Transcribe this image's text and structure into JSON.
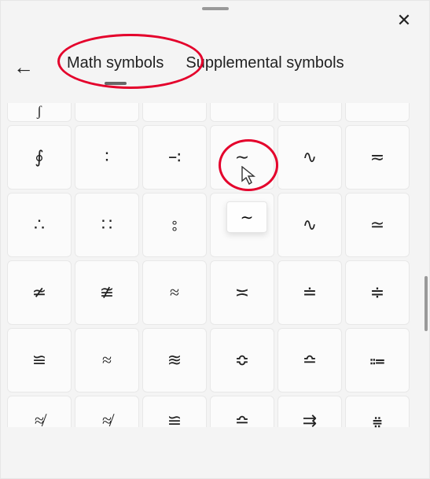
{
  "tabs": {
    "math": "Math symbols",
    "supplemental": "Supplemental symbols"
  },
  "tooltip": "∼",
  "rows": {
    "partial_top": [
      "ʃ",
      "",
      "",
      "",
      "",
      ""
    ],
    "r1": [
      "∮",
      "∶",
      "∹",
      "∼",
      "∿",
      "≂"
    ],
    "r2": [
      "∴",
      "∷",
      "⦂",
      "",
      "∿",
      "≃"
    ],
    "r3": [
      "≄",
      "≇",
      "≈",
      "≍",
      "≐",
      "≑"
    ],
    "r4": [
      "≌",
      "≈",
      "≋",
      "≎",
      "≏",
      "⩴"
    ],
    "r5": [
      "≉",
      "≉",
      "≌",
      "≏",
      "⇉",
      "⩷"
    ]
  }
}
